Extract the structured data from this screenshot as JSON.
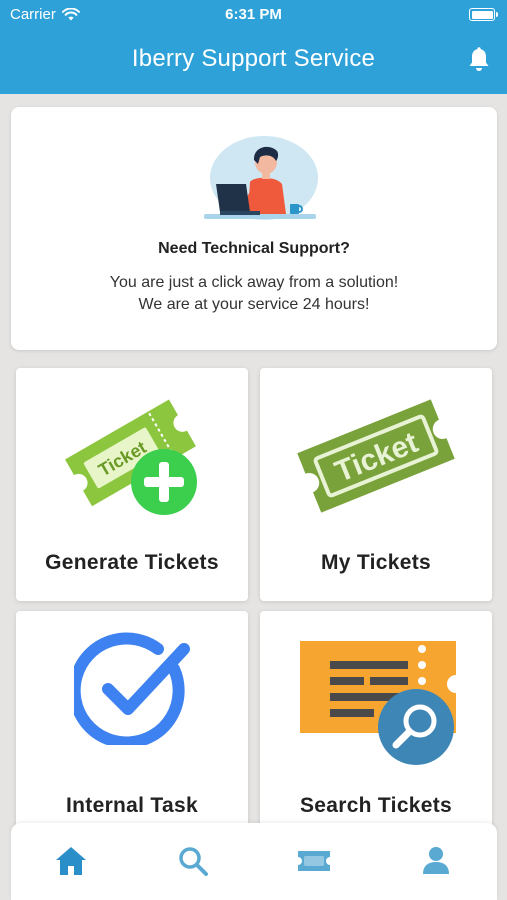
{
  "status_bar": {
    "carrier": "Carrier",
    "time": "6:31 PM"
  },
  "header": {
    "title": "Iberry Support Service"
  },
  "banner": {
    "heading": "Need Technical Support?",
    "line1": "You are just a click away from a solution!",
    "line2": "We are at your service 24 hours!",
    "illustration_icon": "person-at-laptop-icon"
  },
  "tiles": [
    {
      "label": "Generate Tickets",
      "icon": "ticket-plus-icon",
      "ticket_text": "Ticket"
    },
    {
      "label": "My Tickets",
      "icon": "ticket-icon",
      "ticket_text": "Ticket"
    },
    {
      "label": "Internal Task",
      "icon": "checkmark-circle-icon"
    },
    {
      "label": "Search Tickets",
      "icon": "ticket-search-icon"
    }
  ],
  "bottom_nav": [
    {
      "name": "home",
      "icon": "home-icon",
      "active": true
    },
    {
      "name": "search",
      "icon": "search-icon",
      "active": false
    },
    {
      "name": "tickets",
      "icon": "ticket-icon",
      "active": false
    },
    {
      "name": "profile",
      "icon": "person-icon",
      "active": false
    }
  ],
  "colors": {
    "header": "#2ea2d8",
    "background": "#e6e4e2",
    "nav_active": "#2a8fc9",
    "nav_inactive": "#5aa9d3",
    "ticket_green": "#8cc63f",
    "ticket_dark_green": "#7aa23a",
    "plus_green": "#3ccf4e",
    "check_blue": "#3d82f0",
    "search_orange": "#f7a531",
    "search_blue": "#3d86b6"
  }
}
